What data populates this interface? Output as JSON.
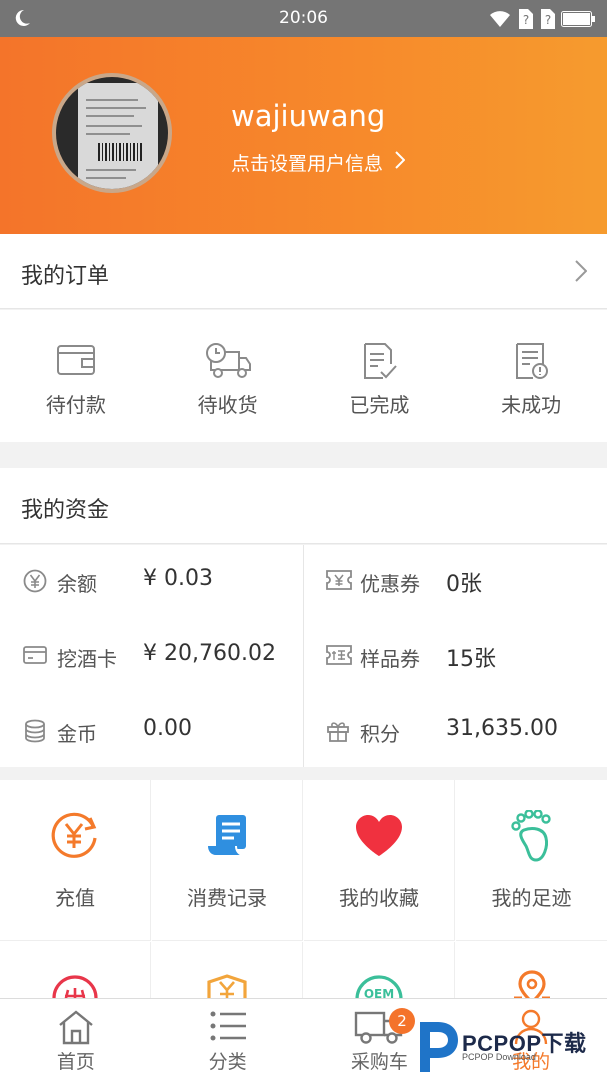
{
  "status_bar": {
    "time": "20:06"
  },
  "profile": {
    "username": "wajiuwang",
    "set_info_link": "点击设置用户信息"
  },
  "orders": {
    "title": "我的订单",
    "items": [
      {
        "label": "待付款",
        "icon": "wallet-icon"
      },
      {
        "label": "待收货",
        "icon": "delivery-truck-icon"
      },
      {
        "label": "已完成",
        "icon": "document-check-icon"
      },
      {
        "label": "未成功",
        "icon": "document-alert-icon"
      }
    ]
  },
  "funds": {
    "title": "我的资金",
    "items": [
      {
        "label": "余额",
        "value": "¥ 0.03",
        "icon": "yen-circle-icon"
      },
      {
        "label": "优惠券",
        "value": "0张",
        "icon": "coupon-icon"
      },
      {
        "label": "挖酒卡",
        "value": "¥ 20,760.02",
        "icon": "card-icon"
      },
      {
        "label": "样品券",
        "value": "15张",
        "icon": "sample-coupon-icon"
      },
      {
        "label": "金币",
        "value": "0.00",
        "icon": "coins-icon"
      },
      {
        "label": "积分",
        "value": "31,635.00",
        "icon": "gift-icon"
      }
    ]
  },
  "functions": {
    "items": [
      {
        "label": "充值",
        "icon": "recharge-icon",
        "color": "#f47a2b"
      },
      {
        "label": "消费记录",
        "icon": "scroll-record-icon",
        "color": "#2f8fe0"
      },
      {
        "label": "我的收藏",
        "icon": "heart-icon",
        "color": "#f0313f"
      },
      {
        "label": "我的足迹",
        "icon": "footprint-icon",
        "color": "#3bbf9a"
      }
    ]
  },
  "tabbar": {
    "items": [
      {
        "label": "首页",
        "icon": "home-icon"
      },
      {
        "label": "分类",
        "icon": "list-icon"
      },
      {
        "label": "采购车",
        "icon": "cart-truck-icon",
        "badge": "2"
      },
      {
        "label": "我的",
        "icon": "user-icon",
        "active": true
      }
    ]
  },
  "watermark": {
    "text": "PCPOP下载",
    "sub": "PCPOP Download"
  },
  "colors": {
    "accent": "#f47a2b",
    "header_start": "#f4742a",
    "header_end": "#f69b2e"
  }
}
